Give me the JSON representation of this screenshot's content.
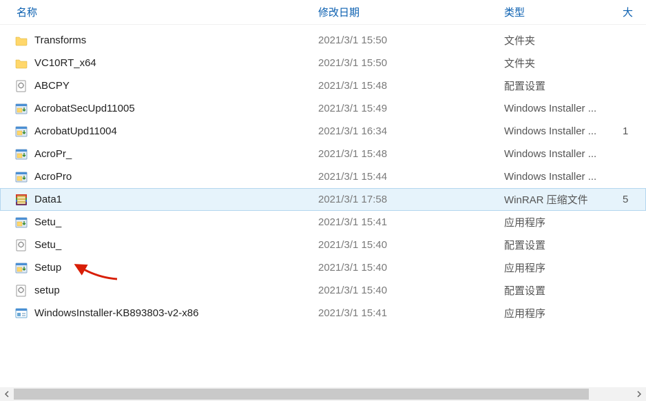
{
  "columns": {
    "name": "名称",
    "date": "修改日期",
    "type": "类型",
    "size": "大"
  },
  "rows": [
    {
      "icon": "folder",
      "name": "Transforms",
      "date": "2021/3/1 15:50",
      "type": "文件夹",
      "size": ""
    },
    {
      "icon": "folder",
      "name": "VC10RT_x64",
      "date": "2021/3/1 15:50",
      "type": "文件夹",
      "size": ""
    },
    {
      "icon": "config",
      "name": "ABCPY",
      "date": "2021/3/1 15:48",
      "type": "配置设置",
      "size": ""
    },
    {
      "icon": "msi",
      "name": "AcrobatSecUpd11005",
      "date": "2021/3/1 15:49",
      "type": "Windows Installer ...",
      "size": ""
    },
    {
      "icon": "msi",
      "name": "AcrobatUpd11004",
      "date": "2021/3/1 16:34",
      "type": "Windows Installer ...",
      "size": "1"
    },
    {
      "icon": "msi",
      "name": "AcroPr_",
      "date": "2021/3/1 15:48",
      "type": "Windows Installer ...",
      "size": ""
    },
    {
      "icon": "msi",
      "name": "AcroPro",
      "date": "2021/3/1 15:44",
      "type": "Windows Installer ...",
      "size": ""
    },
    {
      "icon": "winrar",
      "name": "Data1",
      "date": "2021/3/1 17:58",
      "type": "WinRAR 压缩文件",
      "size": "5",
      "selected": true
    },
    {
      "icon": "app-msi",
      "name": "Setu_",
      "date": "2021/3/1 15:41",
      "type": "应用程序",
      "size": ""
    },
    {
      "icon": "config",
      "name": "Setu_",
      "date": "2021/3/1 15:40",
      "type": "配置设置",
      "size": ""
    },
    {
      "icon": "app-msi",
      "name": "Setup",
      "date": "2021/3/1 15:40",
      "type": "应用程序",
      "size": ""
    },
    {
      "icon": "config",
      "name": "setup",
      "date": "2021/3/1 15:40",
      "type": "配置设置",
      "size": ""
    },
    {
      "icon": "app",
      "name": "WindowsInstaller-KB893803-v2-x86",
      "date": "2021/3/1 15:41",
      "type": "应用程序",
      "size": ""
    }
  ]
}
